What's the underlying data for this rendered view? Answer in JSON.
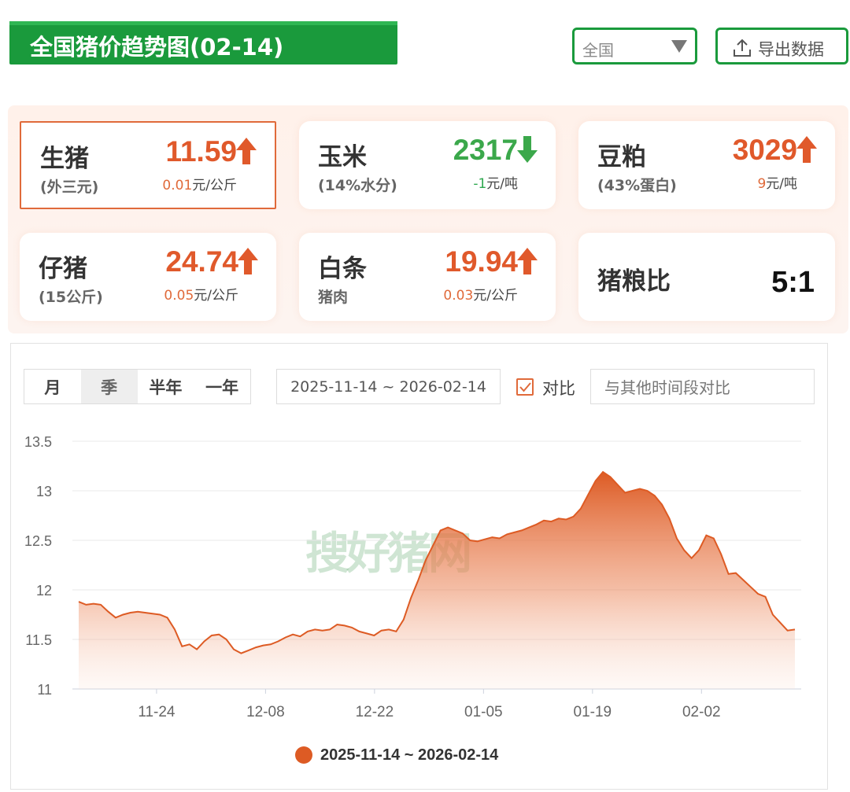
{
  "header": {
    "title": "全国猪价趋势图(02-14)"
  },
  "region_select": {
    "value": "全国"
  },
  "export_button": {
    "label": "导出数据",
    "icon": "upload-icon"
  },
  "cards": [
    {
      "name": "生猪",
      "sub": "(外三元)",
      "price": "11.59",
      "direction": "up",
      "change": "0.01",
      "unit": "元/公斤",
      "active": true
    },
    {
      "name": "玉米",
      "sub": "(14%水分)",
      "price": "2317",
      "direction": "down",
      "change": "-1",
      "unit": "元/吨"
    },
    {
      "name": "豆粕",
      "sub": "(43%蛋白)",
      "price": "3029",
      "direction": "up",
      "change": "9",
      "unit": "元/吨"
    },
    {
      "name": "仔猪",
      "sub": "(15公斤)",
      "price": "24.74",
      "direction": "up",
      "change": "0.05",
      "unit": "元/公斤"
    },
    {
      "name": "白条",
      "sub": "猪肉",
      "price": "19.94",
      "direction": "up",
      "change": "0.03",
      "unit": "元/公斤"
    },
    {
      "name": "猪粮比",
      "ratio": "5:1"
    }
  ],
  "colors": {
    "brand_green": "#1a9a3c",
    "up": "#e0592b",
    "down": "#3ba84b",
    "series": "#dd5b24"
  },
  "period_tabs": [
    "月",
    "季",
    "半年",
    "一年"
  ],
  "period_selected": "季",
  "date_range": "2025-11-14 ~ 2026-02-14",
  "compare": {
    "label": "对比",
    "checked": true,
    "placeholder": "与其他时间段对比"
  },
  "watermark": "搜好猪网",
  "chart_data": {
    "type": "area",
    "xlabel": "",
    "ylabel": "",
    "ylim": [
      11,
      13.5
    ],
    "yticks": [
      "13.5",
      "13",
      "12.5",
      "12",
      "11.5",
      "11"
    ],
    "xticks": [
      "11-24",
      "12-08",
      "12-22",
      "01-05",
      "01-19",
      "02-02"
    ],
    "grid": "horizontal",
    "legend_position": "bottom-center",
    "x_start": "2025-11-14",
    "x_end": "2026-02-14",
    "series": [
      {
        "name": "2025-11-14 ~ 2026-02-14",
        "values": [
          11.88,
          11.85,
          11.86,
          11.85,
          11.78,
          11.72,
          11.75,
          11.77,
          11.78,
          11.77,
          11.76,
          11.75,
          11.72,
          11.6,
          11.43,
          11.45,
          11.4,
          11.48,
          11.54,
          11.55,
          11.5,
          11.4,
          11.36,
          11.39,
          11.42,
          11.44,
          11.45,
          11.48,
          11.52,
          11.55,
          11.53,
          11.58,
          11.6,
          11.59,
          11.6,
          11.65,
          11.64,
          11.62,
          11.58,
          11.56,
          11.54,
          11.59,
          11.6,
          11.58,
          11.7,
          11.92,
          12.1,
          12.3,
          12.45,
          12.6,
          12.63,
          12.6,
          12.57,
          12.5,
          12.49,
          12.51,
          12.53,
          12.52,
          12.56,
          12.58,
          12.6,
          12.63,
          12.66,
          12.7,
          12.69,
          12.72,
          12.71,
          12.74,
          12.82,
          12.96,
          13.1,
          13.19,
          13.14,
          13.06,
          12.98,
          13.0,
          13.02,
          13.0,
          12.95,
          12.86,
          12.72,
          12.52,
          12.4,
          12.32,
          12.4,
          12.55,
          12.52,
          12.36,
          12.16,
          12.17,
          12.1,
          12.03,
          11.96,
          11.93,
          11.75,
          11.67,
          11.59,
          11.6
        ]
      }
    ]
  }
}
